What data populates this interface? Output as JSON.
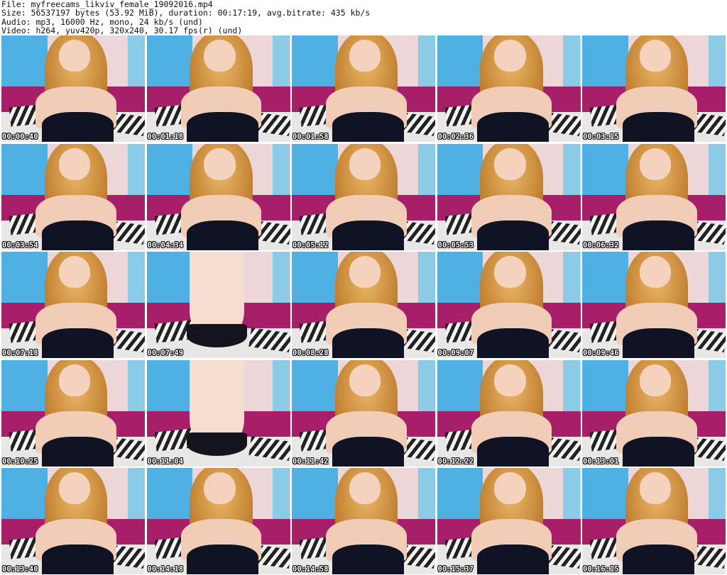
{
  "header": {
    "file_line": "File: myfreecams_likviv_female_19092016.mp4",
    "size_line": "Size: 56537197 bytes (53.92 MiB), duration: 00:17:19, avg.bitrate: 435 kb/s",
    "audio_line": "Audio: mp3, 16000 Hz, mono, 24 kb/s (und)",
    "video_line": "Video: h264, yuv420p, 320x240, 30.17 fps(r) (und)"
  },
  "thumbnails": [
    {
      "time": "00:00:40",
      "pose": "seated"
    },
    {
      "time": "00:01:18",
      "pose": "seated"
    },
    {
      "time": "00:01:58",
      "pose": "seated"
    },
    {
      "time": "00:02:36",
      "pose": "seated"
    },
    {
      "time": "00:03:15",
      "pose": "seated"
    },
    {
      "time": "00:03:54",
      "pose": "seated"
    },
    {
      "time": "00:04:34",
      "pose": "seated"
    },
    {
      "time": "00:05:12",
      "pose": "seated"
    },
    {
      "time": "00:05:53",
      "pose": "seated"
    },
    {
      "time": "00:06:32",
      "pose": "seated"
    },
    {
      "time": "00:07:18",
      "pose": "seated"
    },
    {
      "time": "00:07:49",
      "pose": "standing"
    },
    {
      "time": "00:08:28",
      "pose": "seated"
    },
    {
      "time": "00:09:07",
      "pose": "seated"
    },
    {
      "time": "00:09:46",
      "pose": "seated"
    },
    {
      "time": "00:10:25",
      "pose": "seated"
    },
    {
      "time": "00:11:04",
      "pose": "standing"
    },
    {
      "time": "00:11:42",
      "pose": "seated"
    },
    {
      "time": "00:12:22",
      "pose": "seated"
    },
    {
      "time": "00:13:01",
      "pose": "seated"
    },
    {
      "time": "00:13:40",
      "pose": "seated"
    },
    {
      "time": "00:14:18",
      "pose": "seated"
    },
    {
      "time": "00:14:58",
      "pose": "seated"
    },
    {
      "time": "00:15:37",
      "pose": "seated"
    },
    {
      "time": "00:16:15",
      "pose": "seated"
    }
  ]
}
